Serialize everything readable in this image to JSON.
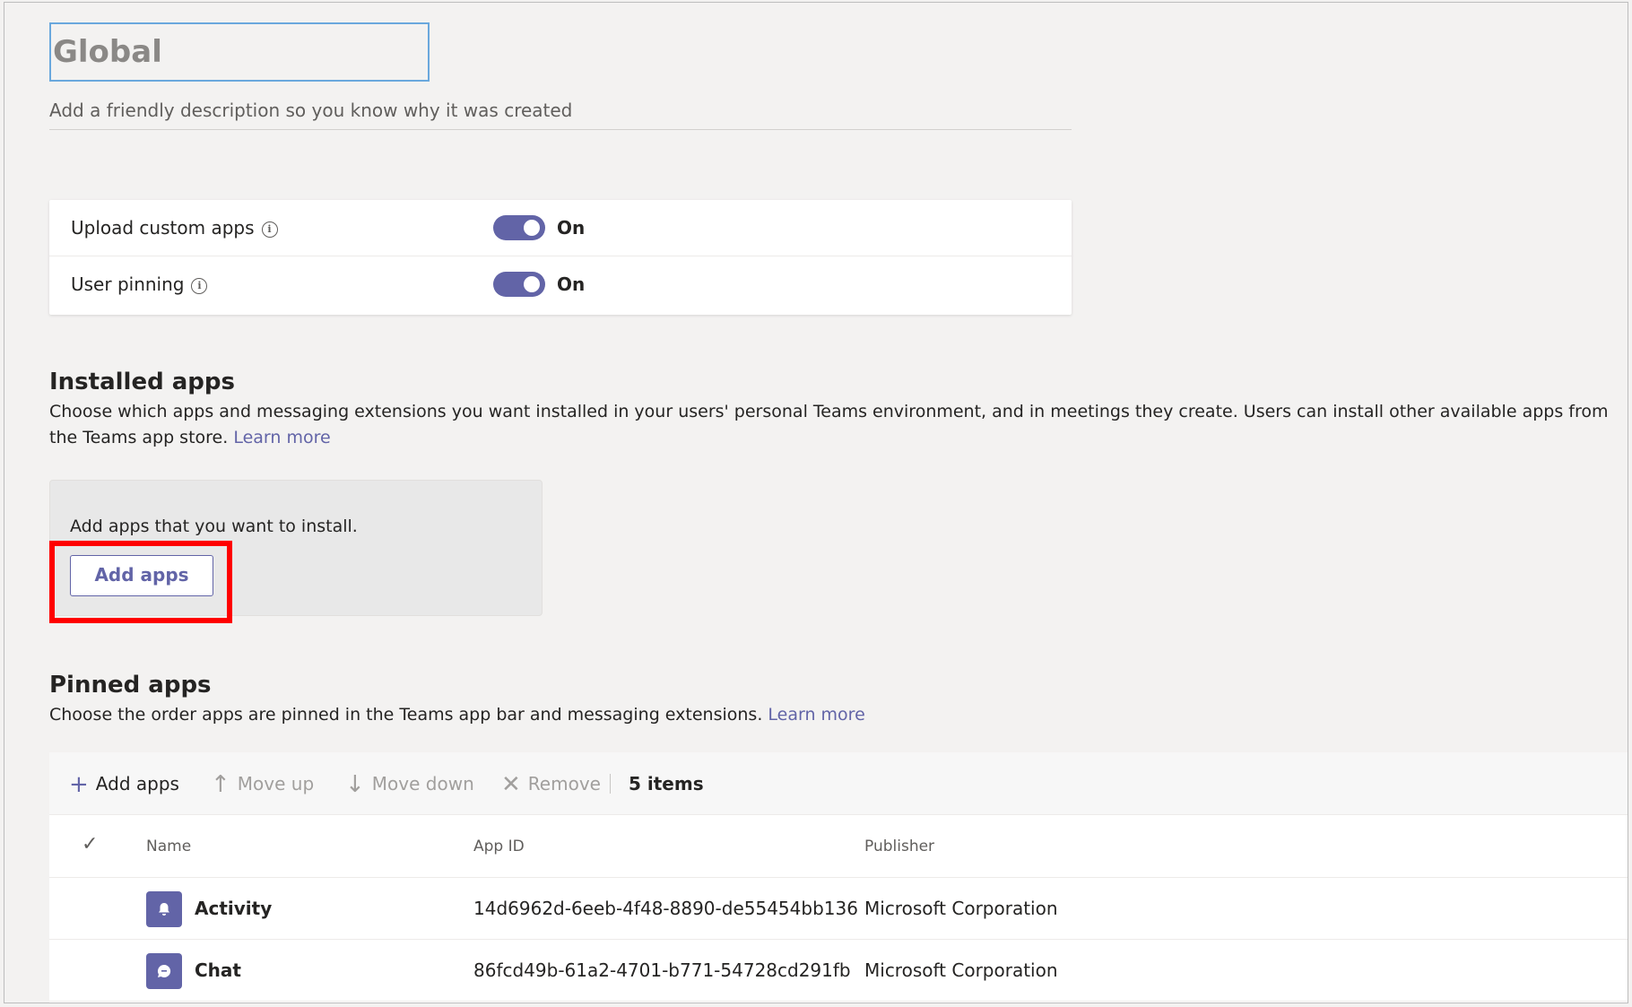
{
  "policy": {
    "name": "Global",
    "description_placeholder": "Add a friendly description so you know why it was created"
  },
  "settings": [
    {
      "label": "Upload custom apps",
      "state": "On"
    },
    {
      "label": "User pinning",
      "state": "On"
    }
  ],
  "installed_apps": {
    "title": "Installed apps",
    "description": "Choose which apps and messaging extensions you want installed in your users' personal Teams environment, and in meetings they create. Users can install other available apps from the Teams app store.",
    "learn_more": "Learn more",
    "box_text": "Add apps that you want to install.",
    "add_button": "Add apps"
  },
  "pinned_apps": {
    "title": "Pinned apps",
    "description": "Choose the order apps are pinned in the Teams app bar and messaging extensions.",
    "learn_more": "Learn more",
    "toolbar": {
      "add": "Add apps",
      "move_up": "Move up",
      "move_down": "Move down",
      "remove": "Remove",
      "count": "5 items"
    },
    "columns": [
      "Name",
      "App ID",
      "Publisher"
    ],
    "rows": [
      {
        "name": "Activity",
        "app_id": "14d6962d-6eeb-4f48-8890-de55454bb136",
        "publisher": "Microsoft Corporation",
        "icon": "bell-icon"
      },
      {
        "name": "Chat",
        "app_id": "86fcd49b-61a2-4701-b771-54728cd291fb",
        "publisher": "Microsoft Corporation",
        "icon": "chat-bubble-icon"
      }
    ]
  },
  "colors": {
    "accent": "#6264a7",
    "highlight": "#ff0000",
    "background": "#f3f2f1"
  }
}
